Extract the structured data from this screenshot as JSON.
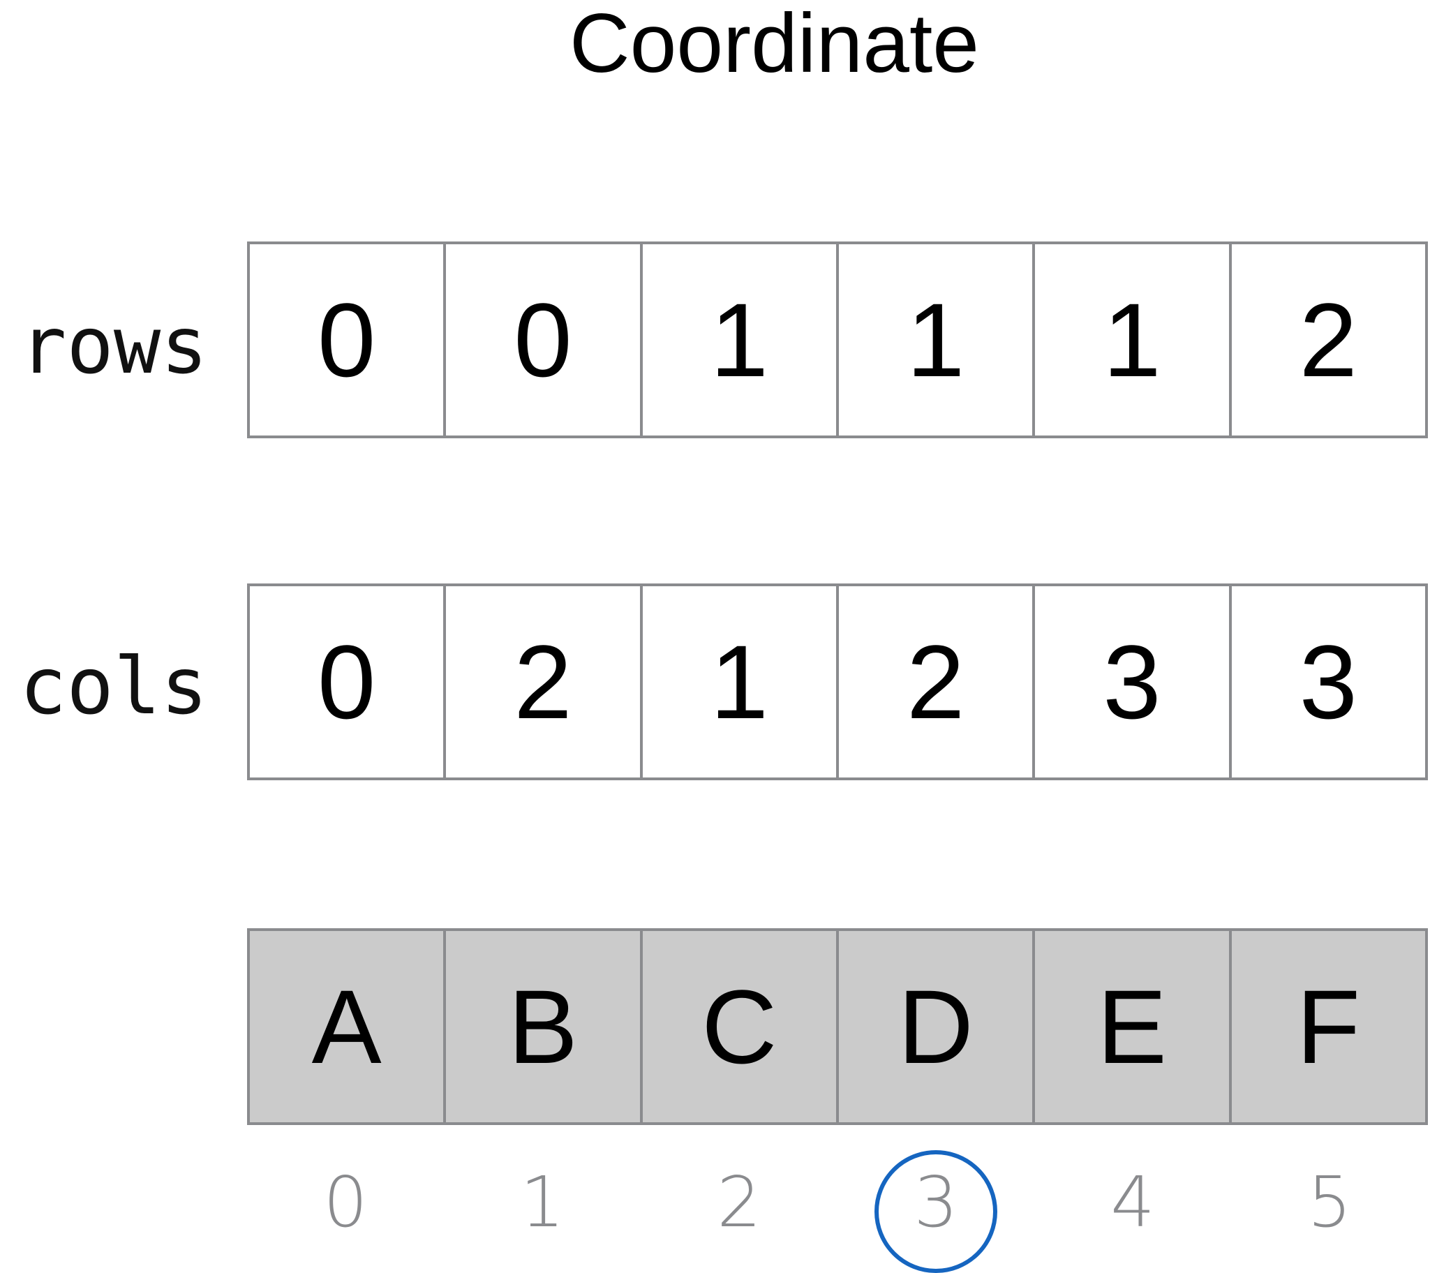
{
  "title": "Coordinate",
  "rows": {
    "label": "rows",
    "values": [
      "0",
      "0",
      "1",
      "1",
      "1",
      "2"
    ]
  },
  "cols": {
    "label": "cols",
    "values": [
      "0",
      "2",
      "1",
      "2",
      "3",
      "3"
    ]
  },
  "data": {
    "values": [
      "A",
      "B",
      "C",
      "D",
      "E",
      "F"
    ]
  },
  "indices": {
    "values": [
      "0",
      "1",
      "2",
      "3",
      "4",
      "5"
    ],
    "highlighted_index": 3,
    "highlight_color": "#1565c0"
  },
  "colors": {
    "cell_border": "#8a8b8e",
    "data_cell_fill": "#cbcbcb",
    "index_text": "#8a8b8e"
  }
}
